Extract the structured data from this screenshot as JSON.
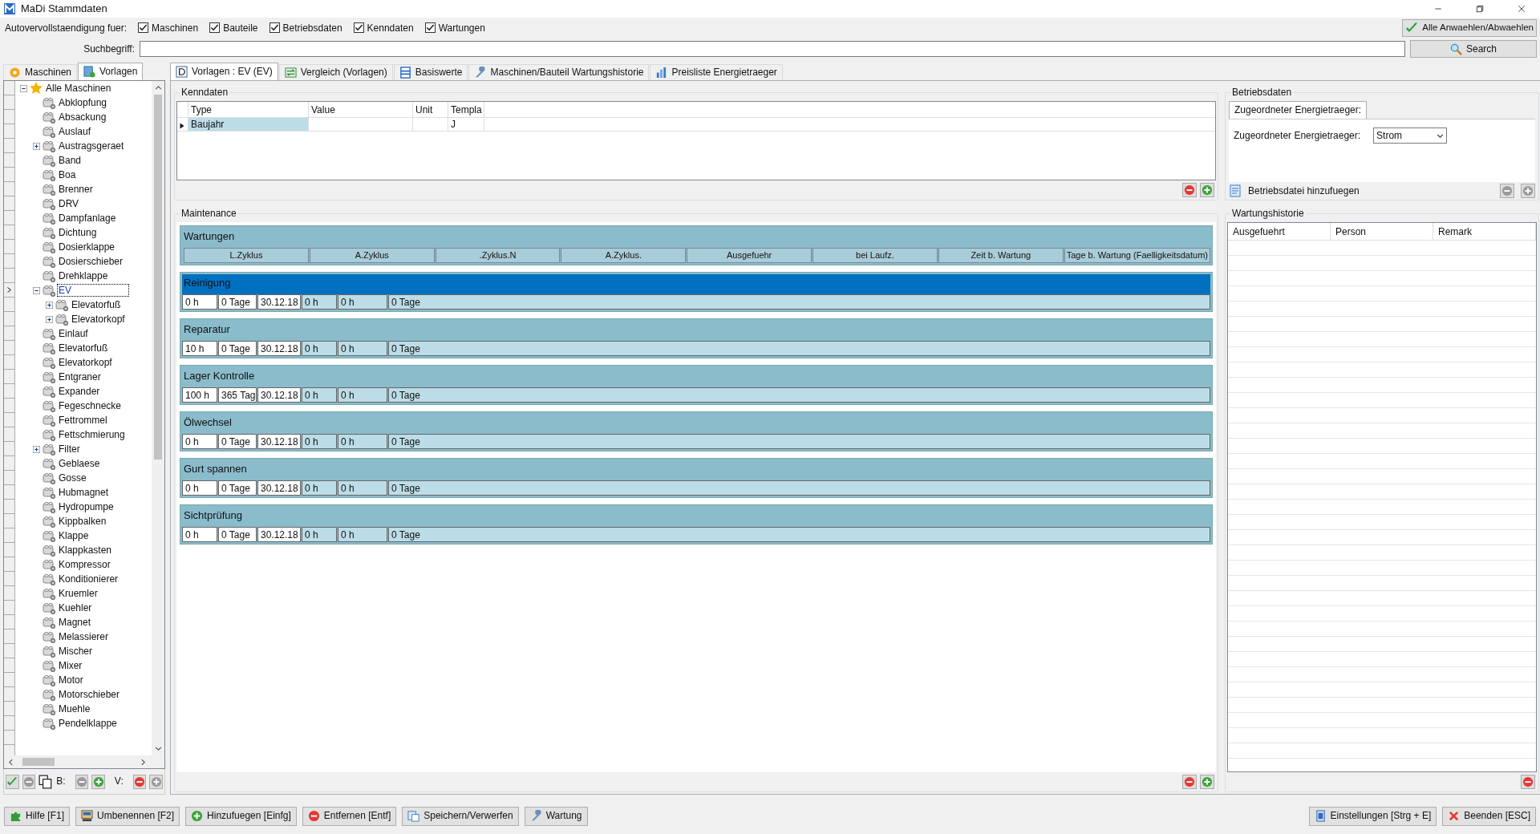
{
  "window": {
    "title": "MaDi Stammdaten"
  },
  "autocomplete": {
    "label": "Autovervollstaendigung fuer:",
    "options": [
      {
        "label": "Maschinen",
        "checked": true
      },
      {
        "label": "Bauteile",
        "checked": true
      },
      {
        "label": "Betriebsdaten",
        "checked": true
      },
      {
        "label": "Kenndaten",
        "checked": true
      },
      {
        "label": "Wartungen",
        "checked": true
      }
    ],
    "select_all_button": "Alle Anwaehlen/Abwaehlen"
  },
  "search": {
    "label": "Suchbegriff:",
    "button": "Search"
  },
  "left_tabs": [
    {
      "label": "Maschinen",
      "selected": false
    },
    {
      "label": "Vorlagen",
      "selected": true
    }
  ],
  "tree": {
    "label": "Alle Maschinen",
    "expanded": true,
    "selected": false,
    "children": [
      {
        "label": "Abklopfung",
        "selected": false
      },
      {
        "label": "Absackung",
        "selected": false
      },
      {
        "label": "Auslauf",
        "selected": false
      },
      {
        "label": "Austragsgeraet",
        "expanded": false,
        "selected": false
      },
      {
        "label": "Band",
        "selected": false
      },
      {
        "label": "Boa",
        "selected": false
      },
      {
        "label": "Brenner",
        "selected": false
      },
      {
        "label": "DRV",
        "selected": false
      },
      {
        "label": "Dampfanlage",
        "selected": false
      },
      {
        "label": "Dichtung",
        "selected": false
      },
      {
        "label": "Dosierklappe",
        "selected": false
      },
      {
        "label": "Dosierschieber",
        "selected": false
      },
      {
        "label": "Drehklappe",
        "selected": false
      },
      {
        "label": "EV",
        "expanded": true,
        "selected": true,
        "children": [
          {
            "label": "Elevatorfuß",
            "expanded": false,
            "selected": false
          },
          {
            "label": "Elevatorkopf",
            "expanded": false,
            "selected": false
          }
        ]
      },
      {
        "label": "Einlauf",
        "selected": false
      },
      {
        "label": "Elevatorfuß",
        "selected": false
      },
      {
        "label": "Elevatorkopf",
        "selected": false
      },
      {
        "label": "Entgraner",
        "selected": false
      },
      {
        "label": "Expander",
        "selected": false
      },
      {
        "label": "Fegeschnecke",
        "selected": false
      },
      {
        "label": "Fettrommel",
        "selected": false
      },
      {
        "label": "Fettschmierung",
        "selected": false
      },
      {
        "label": "Filter",
        "expanded": false,
        "selected": false
      },
      {
        "label": "Geblaese",
        "selected": false
      },
      {
        "label": "Gosse",
        "selected": false
      },
      {
        "label": "Hubmagnet",
        "selected": false
      },
      {
        "label": "Hydropumpe",
        "selected": false
      },
      {
        "label": "Kippbalken",
        "selected": false
      },
      {
        "label": "Klappe",
        "selected": false
      },
      {
        "label": "Klappkasten",
        "selected": false
      },
      {
        "label": "Kompressor",
        "selected": false
      },
      {
        "label": "Konditionierer",
        "selected": false
      },
      {
        "label": "Kruemler",
        "selected": false
      },
      {
        "label": "Kuehler",
        "selected": false
      },
      {
        "label": "Magnet",
        "selected": false
      },
      {
        "label": "Melassierer",
        "selected": false
      },
      {
        "label": "Mischer",
        "selected": false
      },
      {
        "label": "Mixer",
        "selected": false
      },
      {
        "label": "Motor",
        "selected": false
      },
      {
        "label": "Motorschieber",
        "selected": false
      },
      {
        "label": "Muehle",
        "selected": false
      },
      {
        "label": "Pendelklappe",
        "selected": false
      }
    ]
  },
  "left_toolbar": {
    "label_b": "B:",
    "label_v": "V:"
  },
  "main_tabs": [
    {
      "label": "Vorlagen : EV (EV)",
      "selected": true
    },
    {
      "label": "Vergleich (Vorlagen)",
      "selected": false
    },
    {
      "label": "Basiswerte",
      "selected": false
    },
    {
      "label": "Maschinen/Bauteil Wartungshistorie",
      "selected": false
    },
    {
      "label": "Preisliste Energietraeger",
      "selected": false
    }
  ],
  "kenndaten": {
    "title": "Kenndaten",
    "columns": [
      "Type",
      "Value",
      "Unit",
      "Templa"
    ],
    "rows": [
      {
        "cells": [
          "Baujahr",
          null,
          null,
          "J"
        ],
        "current": true
      }
    ]
  },
  "maintenance": {
    "title": "Maintenance",
    "header": {
      "title": "Wartungen",
      "columns": [
        "L.Zyklus",
        "A.Zyklus",
        ".Zyklus.N",
        "A.Zyklus.",
        "Ausgefuehr",
        "bei Laufz.",
        "Zeit b. Wartung",
        "Tage b. Wartung (Faelligkeitsdatum)"
      ]
    },
    "sections": [
      {
        "title": "Reinigung",
        "selected": true,
        "values": [
          "0 h",
          "0 Tage",
          "30.12.18",
          "0 h",
          "0 h",
          "0 Tage"
        ]
      },
      {
        "title": "Reparatur",
        "selected": false,
        "values": [
          "10 h",
          "0 Tage",
          "30.12.18",
          "0 h",
          "0 h",
          "0 Tage"
        ]
      },
      {
        "title": "Lager Kontrolle",
        "selected": false,
        "values": [
          "100 h",
          "365 Tag",
          "30.12.18",
          "0 h",
          "0 h",
          "0 Tage"
        ]
      },
      {
        "title": "Ölwechsel",
        "selected": false,
        "values": [
          "0 h",
          "0 Tage",
          "30.12.18",
          "0 h",
          "0 h",
          "0 Tage"
        ]
      },
      {
        "title": "Gurt spannen",
        "selected": false,
        "values": [
          "0 h",
          "0 Tage",
          "30.12.18",
          "0 h",
          "0 h",
          "0 Tage"
        ]
      },
      {
        "title": "Sichtprüfung",
        "selected": false,
        "values": [
          "0 h",
          "0 Tage",
          "30.12.18",
          "0 h",
          "0 h",
          "0 Tage"
        ]
      }
    ]
  },
  "betriebsdaten": {
    "title": "Betriebsdaten",
    "tab": "Zugeordneter Energietraeger:",
    "field_label": "Zugeordneter Energietraeger:",
    "field_value": "Strom",
    "add_file": "Betriebsdatei hinzufuegen"
  },
  "wartungshistorie": {
    "title": "Wartungshistorie",
    "columns": [
      "Ausgefuehrt",
      "Person",
      "Remark"
    ]
  },
  "bottom_buttons_left": [
    "Hilfe [F1]",
    "Umbenennen [F2]",
    "Hinzufuegen [Einfg]",
    "Entfernen [Entf]",
    "Speichern/Verwerfen",
    "Wartung"
  ],
  "bottom_buttons_right": [
    "Einstellungen [Strg + E]",
    "Beenden [ESC]"
  ]
}
